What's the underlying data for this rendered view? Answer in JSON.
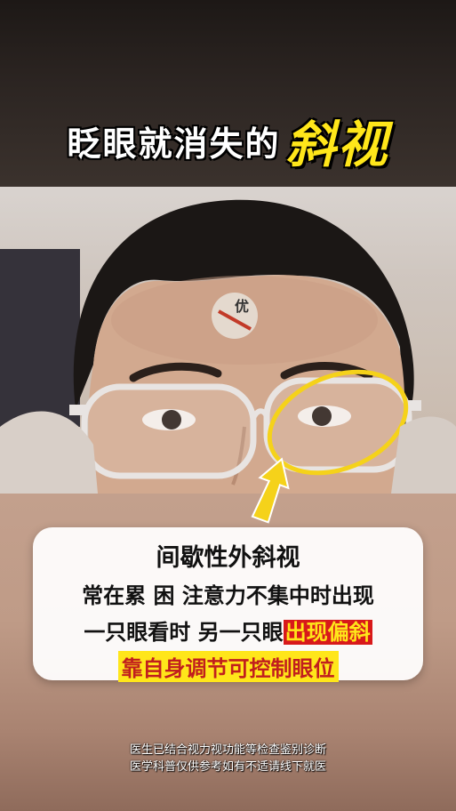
{
  "title": {
    "part1": "眨眼就消失的",
    "part2": "斜视"
  },
  "badge": {
    "text": "优"
  },
  "info_card": {
    "line1": "间歇性外斜视",
    "line2": "常在累 困 注意力不集中时出现",
    "line3_prefix": "一只眼看时 另一只眼",
    "line3_highlight": "出现偏斜",
    "line4": "靠自身调节可控制眼位"
  },
  "disclaimer": {
    "line1": "医生已结合视力视功能等检查鉴别诊断",
    "line2": "医学科普仅供参考如有不适请线下就医"
  },
  "colors": {
    "highlight_yellow": "#ffe61a",
    "highlight_red": "#d8191a",
    "annotation_ring": "#f5d21a"
  }
}
